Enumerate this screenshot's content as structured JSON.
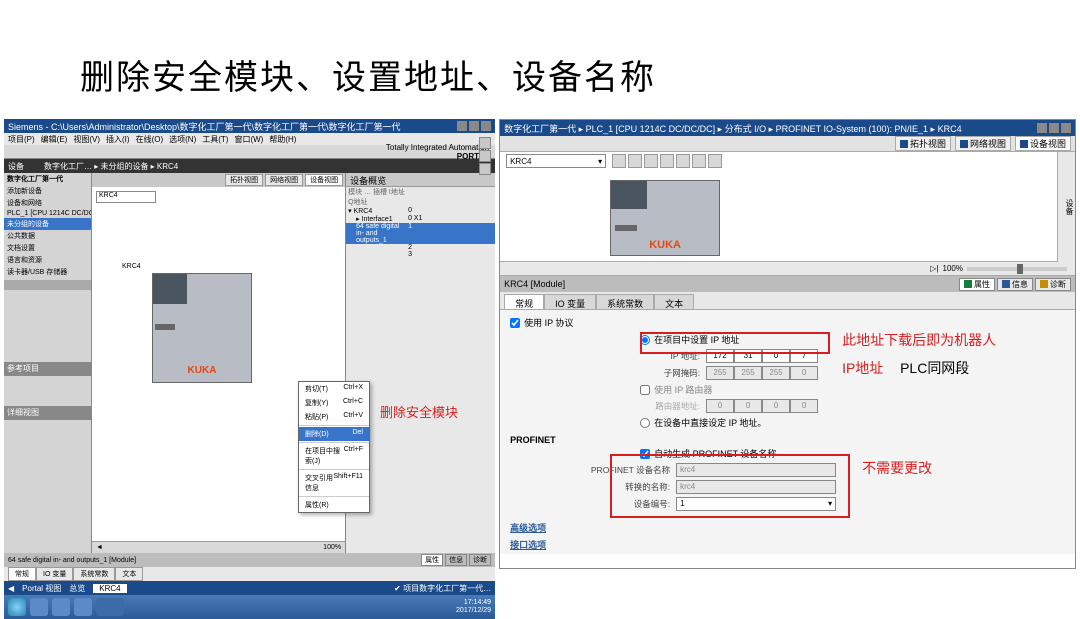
{
  "slide_title": "删除安全模块、设置地址、设备名称",
  "left": {
    "window_title": "Siemens - C:\\Users\\Administrator\\Desktop\\数字化工厂第一代\\数字化工厂第一代\\数字化工厂第一代",
    "menus": [
      "项目(P)",
      "编辑(E)",
      "视图(V)",
      "插入(I)",
      "在线(O)",
      "选项(N)",
      "工具(T)",
      "窗口(W)",
      "帮助(H)"
    ],
    "branding": "Totally Integrated Automation",
    "branding2": "PORTAL",
    "nav_hdr": "设备",
    "breadcrumb": "数字化工厂… ▸ 未分组的设备 ▸ KRC4",
    "canvas_tabs": [
      "拓扑视图",
      "网络视图",
      "设备视图"
    ],
    "device_combo": "KRC4",
    "tree_root": "数字化工厂第一代",
    "tree_items": [
      "添加新设备",
      "设备和网络",
      "PLC_1 [CPU 1214C DC/DC/DC]",
      "未分组的设备",
      "公共数据",
      "文档设置",
      "语言和资源",
      "读卡器/USB 存储器"
    ],
    "tree_refs_hdr": "参考项目",
    "tree_details_hdr": "详细视图",
    "kuka": "KUKA",
    "overview_hdr": "设备概览",
    "overview_cols": "模块 … 插槽 I地址 Q地址",
    "overview_rows": [
      {
        "name": "KRC4",
        "slot": "0"
      },
      {
        "name": "Interface1",
        "slot": "0 X1"
      },
      {
        "name": "64 safe digital in- and outputs_1",
        "slot": "1",
        "ia": "2",
        "qa": ""
      },
      {
        "name": "",
        "slot": "2"
      },
      {
        "name": "",
        "slot": "3"
      }
    ],
    "ctx_items": [
      {
        "l": "剪切(T)",
        "k": "Ctrl+X"
      },
      {
        "l": "复制(Y)",
        "k": "Ctrl+C"
      },
      {
        "l": "粘贴(P)",
        "k": "Ctrl+V"
      },
      {
        "l": "删除(D)",
        "k": "Del"
      },
      {
        "l": "在项目中搜索(J)",
        "k": "Ctrl+F"
      },
      {
        "l": "交叉引用信息",
        "k": "Shift+F11"
      },
      {
        "l": "属性(R)",
        "k": ""
      }
    ],
    "ctx_sel_idx": 3,
    "anno1": "删除安全模块",
    "zoom": "100%",
    "bottom_module": "64 safe digital in- and outputs_1 [Module]",
    "bottom_tabs": [
      "属性",
      "信息",
      "诊断"
    ],
    "bottom_subtabs": [
      "常规",
      "IO 变量",
      "系统常数",
      "文本"
    ],
    "status_items": [
      "Portal 视图",
      "总览",
      "KRC4"
    ],
    "status_msg": "✔ 项目数字化工厂第一代…",
    "time1": "17:14:49",
    "time2": "2017/12/29"
  },
  "right": {
    "title": "数字化工厂第一代 ▸ PLC_1 [CPU 1214C DC/DC/DC] ▸ 分布式 I/O ▸ PROFINET IO-System (100): PN/IE_1 ▸ KRC4",
    "view_tabs": [
      "拓扑视图",
      "网络视图",
      "设备视图"
    ],
    "active_view": "设备视图",
    "device_combo": "KRC4",
    "side_label": "设备",
    "kuka": "KUKA",
    "zoom_value": "100%",
    "props_hdr": "KRC4 [Module]",
    "rtabs": [
      "属性",
      "信息",
      "诊断"
    ],
    "tabs": [
      "常规",
      "IO 变量",
      "系统常数",
      "文本"
    ],
    "cb_ip": "使用 IP 协议",
    "r1": "在项目中设置 IP 地址",
    "ip_label": "IP 地址:",
    "ip": [
      "172",
      "31",
      "0",
      "7"
    ],
    "mask_label": "子网掩码:",
    "mask": [
      "255",
      "255",
      "255",
      "0"
    ],
    "cb_router": "使用 IP 路由器",
    "router_label": "路由器地址:",
    "router": [
      "0",
      "0",
      "0",
      "0"
    ],
    "r2": "在设备中直接设定 IP 地址。",
    "section_profinet": "PROFINET",
    "cb_autoname": "自动生成 PROFINET 设备名称",
    "name_label": "PROFINET 设备名称",
    "name_val": "krc4",
    "conv_label": "转换的名称:",
    "conv_val": "krc4",
    "num_label": "设备编号:",
    "num_val": "1",
    "adv_label": "高级选项",
    "intf_label": "接口选项",
    "anno_ip1": "此地址下载后即为机器人",
    "anno_ip2": "IP地址",
    "anno_seg": "PLC同网段",
    "anno_noneed": "不需要更改"
  }
}
